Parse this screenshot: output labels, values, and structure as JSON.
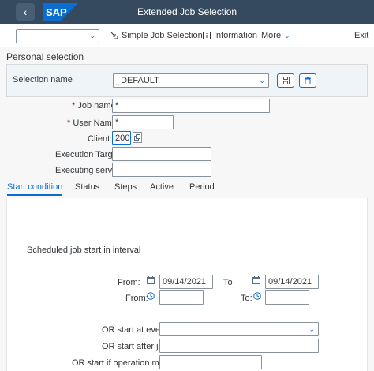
{
  "shell": {
    "title": "Extended Job Selection",
    "logo_text": "SAP",
    "brand_color": "#0a6ed1"
  },
  "toolbar": {
    "variant_select_value": "",
    "simple_job_selection": "Simple Job Selection",
    "information": "Information",
    "more": "More",
    "exit": "Exit"
  },
  "personal_selection": {
    "title": "Personal selection",
    "selection_name_label": "Selection name",
    "selection_name_value": "_DEFAULT"
  },
  "criteria": {
    "job_name_label": "Job name:",
    "job_name_value": "*",
    "user_name_label": "User Name:",
    "user_name_value": "*",
    "client_label": "Client:",
    "client_value": "200",
    "execution_target_label": "Execution Target:",
    "execution_target_value": "",
    "executing_server_label": "Executing server:",
    "executing_server_value": "",
    "required_mark": "*"
  },
  "tabs": [
    {
      "label": "Start condition",
      "active": true
    },
    {
      "label": "Status",
      "active": false
    },
    {
      "label": "Steps",
      "active": false
    },
    {
      "label": "Active",
      "active": false
    },
    {
      "label": "Period",
      "active": false
    }
  ],
  "start_condition": {
    "interval_heading": "Scheduled job start in interval",
    "from_date_label": "From:",
    "from_date_value": "09/14/2021",
    "to_date_label": "To",
    "to_date_value": "09/14/2021",
    "from_time_label": "From:",
    "from_time_value": "",
    "to_time_label": "To:",
    "to_time_value": "",
    "event_label": "OR start at event:",
    "event_value": "",
    "after_job_label": "OR start after job:",
    "after_job_value": "",
    "op_mode_label": "OR start if operation mode:",
    "op_mode_value": ""
  }
}
